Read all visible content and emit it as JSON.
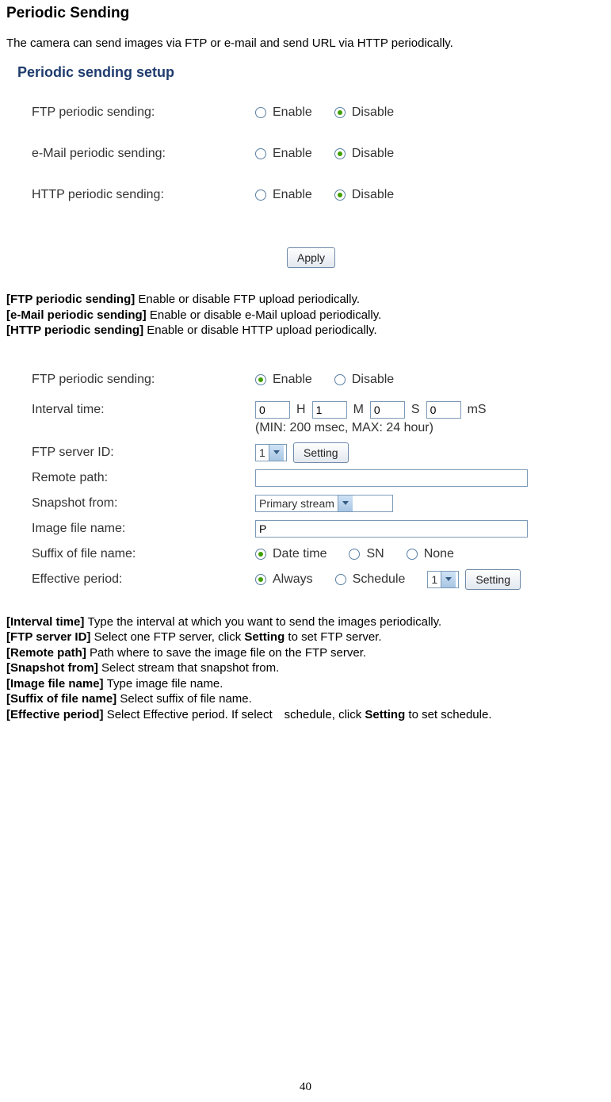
{
  "title": "Periodic Sending",
  "intro": "The camera can send images via FTP or e-mail and send URL via HTTP periodically.",
  "panel1": {
    "heading": "Periodic sending setup",
    "enable": "Enable",
    "disable": "Disable",
    "rows": {
      "ftp": "FTP periodic sending:",
      "mail": "e-Mail periodic sending:",
      "http": "HTTP periodic sending:"
    },
    "apply": "Apply"
  },
  "defs1": [
    {
      "b": "[FTP periodic sending] ",
      "t": "Enable or disable FTP upload periodically."
    },
    {
      "b": "[e-Mail periodic sending] ",
      "t": "Enable or disable e-Mail upload periodically."
    },
    {
      "b": "[HTTP periodic sending] ",
      "t": "Enable or disable HTTP upload periodically."
    }
  ],
  "panel2": {
    "labels": {
      "ftp": "FTP periodic sending:",
      "interval": "Interval time:",
      "serverid": "FTP server ID:",
      "remote": "Remote path:",
      "snap": "Snapshot from:",
      "imgname": "Image file name:",
      "suffix": "Suffix of file name:",
      "effective": "Effective period:"
    },
    "enable": "Enable",
    "disable": "Disable",
    "interval": {
      "h": "0",
      "m": "1",
      "s": "0",
      "ms": "0",
      "hL": "H",
      "mL": "M",
      "sL": "S",
      "msL": "mS",
      "hint": "(MIN: 200 msec, MAX: 24 hour)"
    },
    "serverid": "1",
    "setting": "Setting",
    "snap": "Primary stream",
    "imgname": "P",
    "suffixOpts": {
      "datetime": "Date time",
      "sn": "SN",
      "none": "None"
    },
    "effectiveOpts": {
      "always": "Always",
      "schedule": "Schedule"
    },
    "effSelect": "1"
  },
  "defs2": [
    {
      "b": "[Interval time] ",
      "t": "Type the interval at which you want to send the images periodically."
    },
    {
      "b": "[FTP server ID] ",
      "t": "Select one FTP server, click ",
      "b2": "Setting",
      "t2": " to set FTP server."
    },
    {
      "b": "[Remote path] ",
      "t": "Path where to save the image file on the FTP server."
    },
    {
      "b": "[Snapshot from] ",
      "t": "Select stream that snapshot from."
    },
    {
      "b": "[Image file name] ",
      "t": "Type image file name."
    },
    {
      "b": "[Suffix of file name] ",
      "t": "Select suffix of file name."
    },
    {
      "b": "[Effective period] ",
      "t": "Select Effective period. If select schedule, click ",
      "b2": "Setting",
      "t2": " to set schedule."
    }
  ],
  "pagenum": "40"
}
